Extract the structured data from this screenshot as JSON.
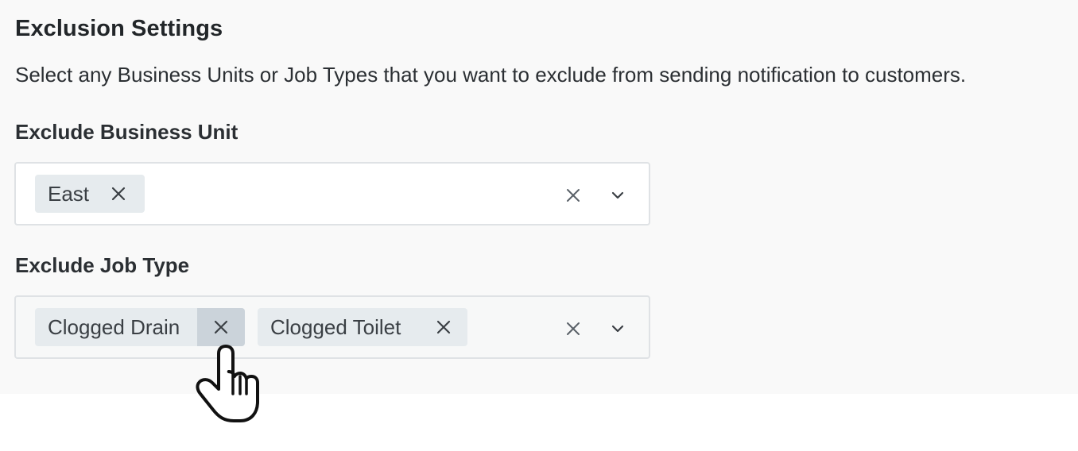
{
  "section": {
    "title": "Exclusion Settings",
    "description": "Select any Business Units or Job Types that you want to exclude from sending notification to customers."
  },
  "business_unit": {
    "label": "Exclude Business Unit",
    "chips": [
      {
        "label": "East",
        "remove_icon": "close-icon"
      }
    ],
    "clear_icon": "close-icon",
    "dropdown_icon": "chevron-down-icon"
  },
  "job_type": {
    "label": "Exclude Job Type",
    "chips": [
      {
        "label": "Clogged Drain",
        "remove_icon": "close-icon"
      },
      {
        "label": "Clogged Toilet",
        "remove_icon": "close-icon"
      }
    ],
    "clear_icon": "close-icon",
    "dropdown_icon": "chevron-down-icon"
  },
  "cursor": {
    "type": "hand-pointer-icon"
  },
  "colors": {
    "chip_background": "#e6ebee",
    "chip_remove_hover": "#cbd3da",
    "panel_background": "#f9f9f9",
    "border": "#dfe2e5"
  }
}
